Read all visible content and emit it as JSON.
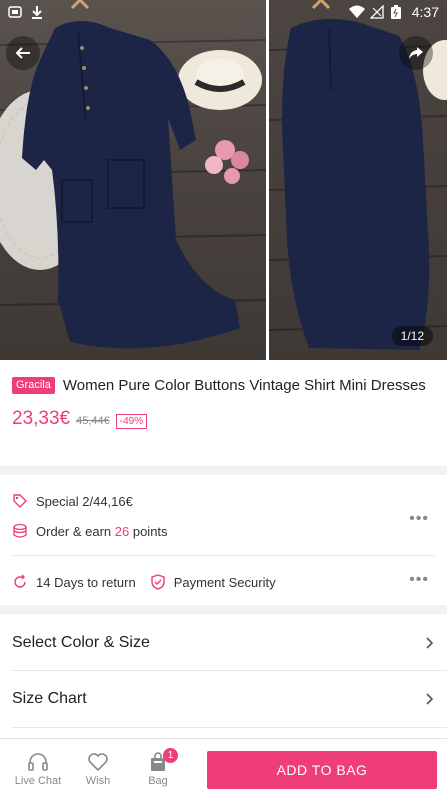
{
  "status_bar": {
    "time": "4:37"
  },
  "gallery": {
    "counter": "1/12"
  },
  "product": {
    "brand": "Gracila",
    "title": "Women Pure Color Buttons Vintage Shirt Mini Dresses",
    "price": "23,33€",
    "old_price": "45,44€",
    "discount": "-49%"
  },
  "promo": {
    "special": "Special 2/44,16€",
    "earn_prefix": "Order & earn ",
    "earn_points": "26",
    "earn_suffix": " points",
    "return_policy": "14 Days to return",
    "payment": "Payment Security"
  },
  "options": {
    "select_color_size": "Select Color & Size",
    "size_chart": "Size Chart"
  },
  "bottom_bar": {
    "live_chat": "Live Chat",
    "wish": "Wish",
    "bag": "Bag",
    "bag_count": "1",
    "add_to_bag": "ADD TO BAG"
  },
  "colors": {
    "accent": "#ee3d7a",
    "dress": "#1d2547"
  }
}
